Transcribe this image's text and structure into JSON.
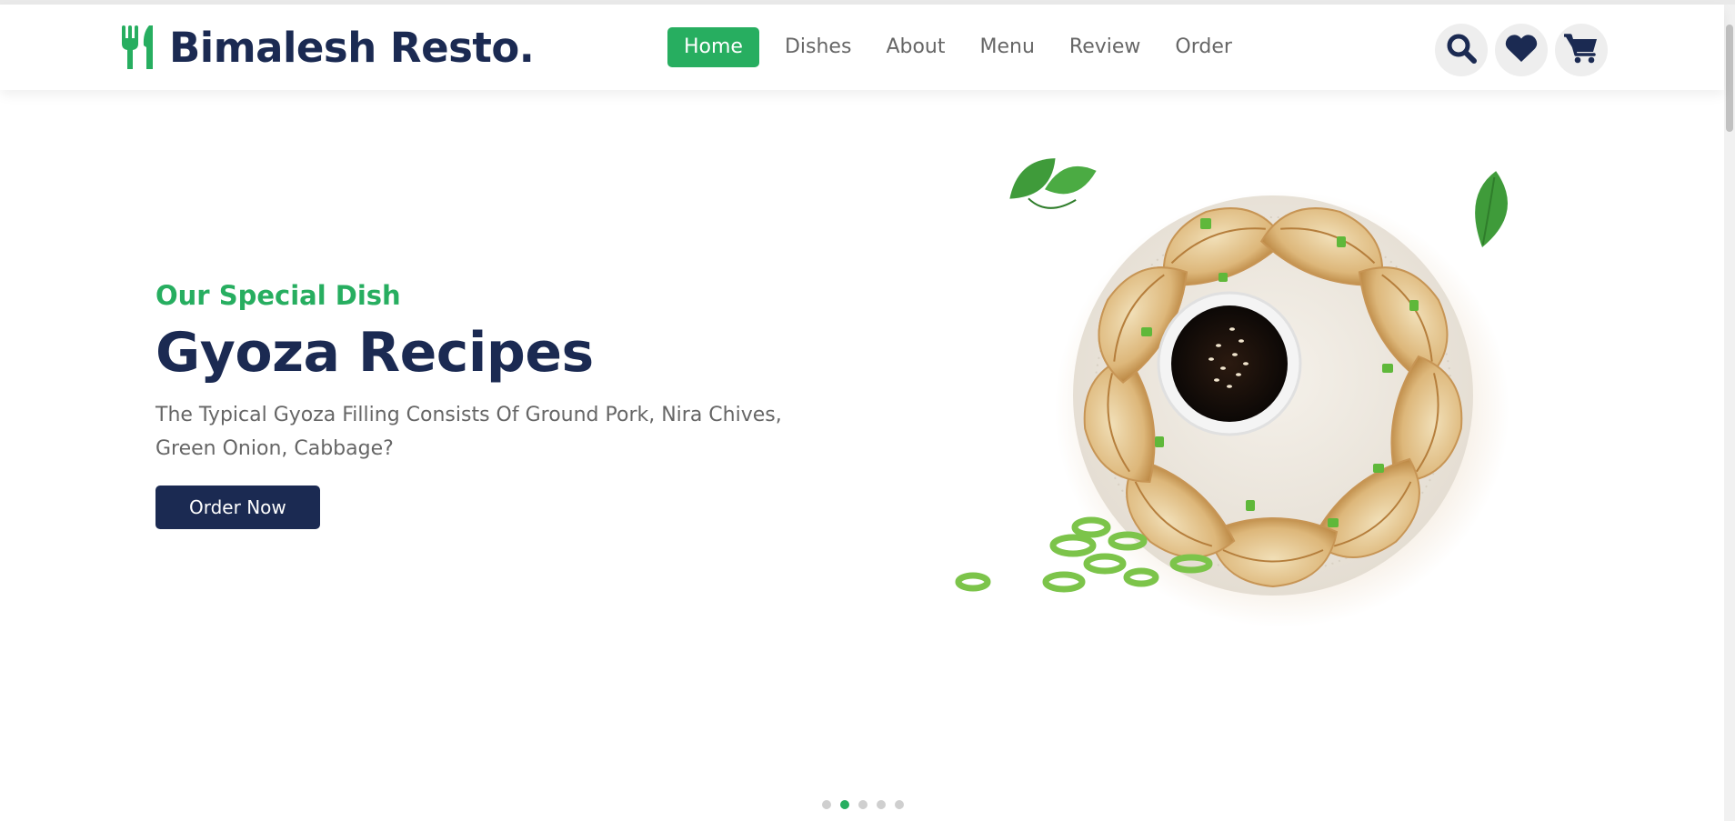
{
  "brand": {
    "name": "Bimalesh Resto.",
    "logo_icon": "utensils-icon",
    "accent_color": "#27ae60",
    "dark_color": "#1b2a52"
  },
  "nav": {
    "items": [
      "Home",
      "Dishes",
      "About",
      "Menu",
      "Review",
      "Order"
    ],
    "active": "Home"
  },
  "header_icons": [
    "search-icon",
    "heart-icon",
    "cart-icon"
  ],
  "hero": {
    "subtitle": "Our Special Dish",
    "title": "Gyoza Recipes",
    "description": "The Typical Gyoza Filling Consists Of Ground Pork, Nira Chives, Green Onion, Cabbage?",
    "button_label": "Order Now",
    "image": "gyoza-dumplings-plate"
  },
  "slider": {
    "slide_count": 5,
    "active_slide": 2
  }
}
